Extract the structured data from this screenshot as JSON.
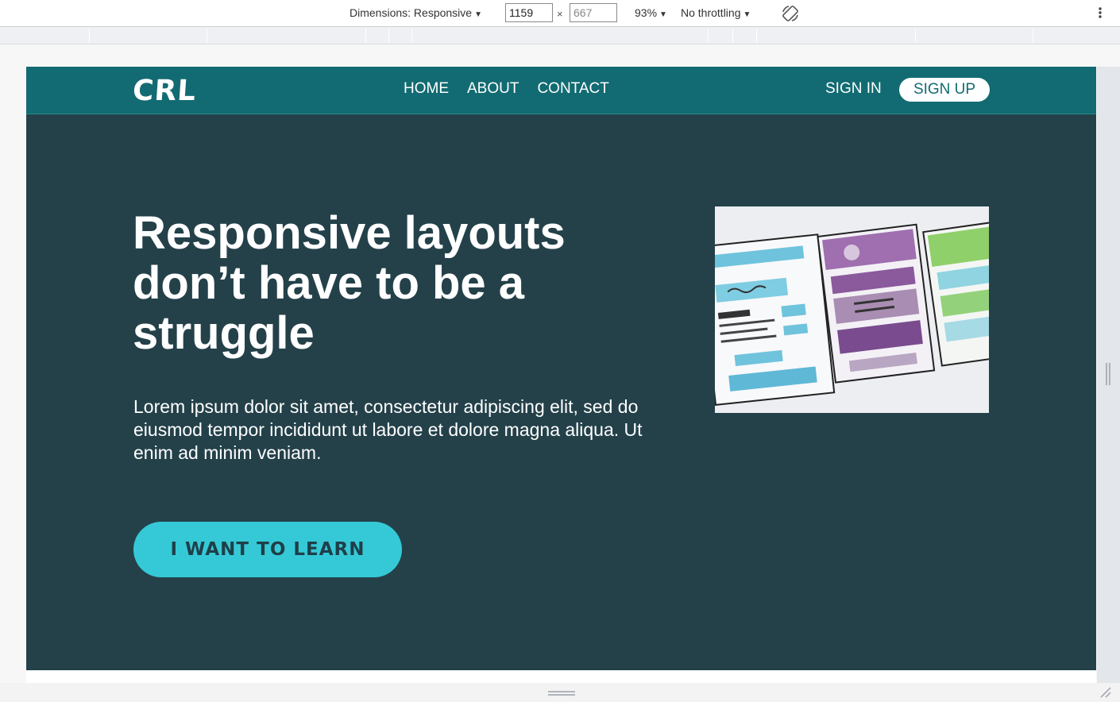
{
  "devtools": {
    "dimensions_label": "Dimensions: Responsive",
    "width_value": "1159",
    "height_placeholder": "667",
    "times": "×",
    "zoom": "93%",
    "throttling": "No throttling",
    "icons": {
      "rotate": "rotate-icon",
      "more": "more-vertical-icon",
      "resize": "resize-handle-icon"
    }
  },
  "site": {
    "logo": "CRL",
    "nav": {
      "links": [
        "HOME",
        "ABOUT",
        "CONTACT"
      ],
      "sign_in": "SIGN IN",
      "sign_up": "SIGN UP"
    },
    "hero": {
      "title": "Responsive layouts don’t have to be a struggle",
      "text": "Lorem ipsum dolor sit amet, consectetur adipiscing elit, sed do eiusmod tempor incididunt ut labore et dolore magna aliqua. Ut enim ad minim veniam.",
      "cta": "I WANT TO LEARN"
    },
    "colors": {
      "nav_bg": "#126b72",
      "hero_bg": "#24414a",
      "cta_bg": "#35c9d7",
      "cta_text": "#1f3f48"
    }
  }
}
